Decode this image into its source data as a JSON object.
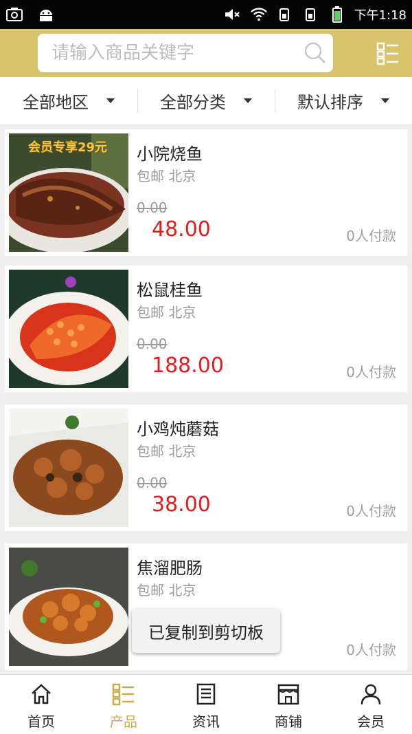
{
  "status_bar": {
    "time": "下午1:18"
  },
  "search": {
    "placeholder": "请输入商品关键字"
  },
  "filters": [
    {
      "label": "全部地区"
    },
    {
      "label": "全部分类"
    },
    {
      "label": "默认排序"
    }
  ],
  "products": [
    {
      "name": "小院烧鱼",
      "location": "包邮 北京",
      "original_price": "0.00",
      "price": "48.00",
      "paid": "0人付款",
      "promo": "会员专享29元"
    },
    {
      "name": "松鼠桂鱼",
      "location": "包邮 北京",
      "original_price": "0.00",
      "price": "188.00",
      "paid": "0人付款"
    },
    {
      "name": "小鸡炖蘑菇",
      "location": "包邮 北京",
      "original_price": "0.00",
      "price": "38.00",
      "paid": "0人付款"
    },
    {
      "name": "焦溜肥肠",
      "location": "包邮 北京",
      "original_price": "",
      "price": "",
      "paid": "0人付款"
    }
  ],
  "toast": {
    "text": "已复制到剪切板"
  },
  "bottom_nav": [
    {
      "label": "首页",
      "icon": "home-icon",
      "active": false
    },
    {
      "label": "产品",
      "icon": "product-grid-icon",
      "active": true
    },
    {
      "label": "资讯",
      "icon": "news-icon",
      "active": false
    },
    {
      "label": "商铺",
      "icon": "shop-icon",
      "active": false
    },
    {
      "label": "会员",
      "icon": "member-icon",
      "active": false
    }
  ],
  "colors": {
    "header_bg": "#d8c46d",
    "price_red": "#e11c1c",
    "active_gold": "#c9ad4d"
  }
}
